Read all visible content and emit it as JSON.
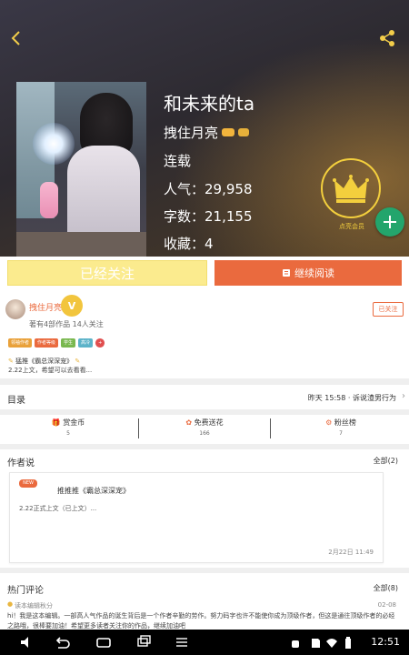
{
  "book": {
    "title": "和未来的ta",
    "author": "拽住月亮",
    "status": "连载",
    "popularity": "人气：29,958",
    "word_count": "字数：21,155",
    "favorites": "收藏：4",
    "vip_label": "点亮会员"
  },
  "actions": {
    "primary_label": "已经关注",
    "read_label": "继续阅读"
  },
  "author": {
    "name": "拽住月亮",
    "level": "V",
    "meta": "著有4部作品 14人关注",
    "follow_label": "已关注",
    "tags": [
      "领袖作者",
      "作者等级",
      "学生",
      "高冷",
      "+"
    ]
  },
  "recommend": {
    "line1": "猛推《霸总深深宠》",
    "line2": "2.22上文，希望可以去看看..."
  },
  "directory": {
    "label": "目录",
    "update": "昨天 15:58 · 诉说渣男行为"
  },
  "stats": [
    {
      "label": "赏金币",
      "value": "5"
    },
    {
      "label": "免费送花",
      "value": "166"
    },
    {
      "label": "粉丝榜",
      "value": "7"
    }
  ],
  "author_note": {
    "section": "作者说",
    "all": "全部(2)",
    "badge": "NEW",
    "title": "推推推《霸总深深宠》",
    "body": "2.22正式上文（已上文）...",
    "time": "2月22日 11:49"
  },
  "comments": {
    "section": "热门评论",
    "all": "全部(8)",
    "user": "读本编辑秋分",
    "date": "02-08",
    "text": "hi！我是这本编辑。一部高人气作品的诞生背后是一个作者辛勤的劳作。努力码字也许不能使你成为顶级作者，但这是通往顶级作者的必经之路哦，很棒要加油！希望更多读者关注你的作品，继续加油吧"
  },
  "system": {
    "time": "12:51"
  },
  "colors": {
    "accent": "#ea6a3e",
    "yellow": "#fbeb8e",
    "green": "#23a56c",
    "gold": "#f3cf3d"
  }
}
